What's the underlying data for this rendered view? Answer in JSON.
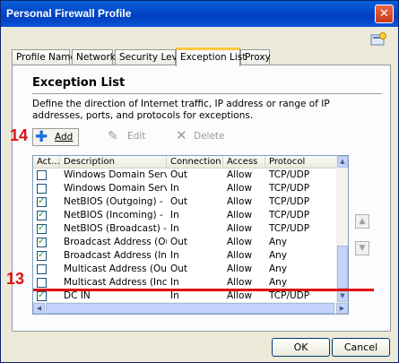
{
  "window": {
    "title": "Personal Firewall Profile",
    "close_label": "✕"
  },
  "tabs": [
    {
      "label": "Profile Name"
    },
    {
      "label": "Network"
    },
    {
      "label": "Security Level"
    },
    {
      "label": "Exception List"
    },
    {
      "label": "Proxy"
    }
  ],
  "active_tab": "Exception List",
  "section": {
    "title": "Exception List",
    "description": "Define the direction of Internet traffic, IP address or range of IP addresses, ports, and protocols for exceptions."
  },
  "toolbar": {
    "add_label": "Add",
    "edit_label": "Edit",
    "delete_label": "Delete"
  },
  "grid": {
    "columns": [
      "Act...",
      "Description",
      "Connection",
      "Access",
      "Protocol"
    ],
    "rows": [
      {
        "checked": false,
        "description": "Windows Domain Servi...",
        "connection": "Out",
        "access": "Allow",
        "protocol": "TCP/UDP"
      },
      {
        "checked": false,
        "description": "Windows Domain Servi...",
        "connection": "In",
        "access": "Allow",
        "protocol": "TCP/UDP"
      },
      {
        "checked": true,
        "description": "NetBIOS (Outgoing) - D...",
        "connection": "Out",
        "access": "Allow",
        "protocol": "TCP/UDP"
      },
      {
        "checked": true,
        "description": "NetBIOS (Incoming) - D...",
        "connection": "In",
        "access": "Allow",
        "protocol": "TCP/UDP"
      },
      {
        "checked": true,
        "description": "NetBIOS (Broadcast) - ...",
        "connection": "In",
        "access": "Allow",
        "protocol": "TCP/UDP"
      },
      {
        "checked": true,
        "description": "Broadcast Address (Ou...",
        "connection": "Out",
        "access": "Allow",
        "protocol": "Any"
      },
      {
        "checked": true,
        "description": "Broadcast Address (Inc...",
        "connection": "In",
        "access": "Allow",
        "protocol": "Any"
      },
      {
        "checked": false,
        "description": "Multicast Address (Out...",
        "connection": "Out",
        "access": "Allow",
        "protocol": "Any"
      },
      {
        "checked": false,
        "description": "Multicast Address (Inco...",
        "connection": "In",
        "access": "Allow",
        "protocol": "Any"
      },
      {
        "checked": true,
        "description": "DC IN",
        "connection": "In",
        "access": "Allow",
        "protocol": "TCP/UDP"
      }
    ]
  },
  "buttons": {
    "ok": "OK",
    "cancel": "Cancel"
  },
  "annotations": {
    "step_add": "14",
    "step_row": "13"
  },
  "colors": {
    "title_bar": "#0040c0",
    "annotation": "#e01010",
    "checkbox_check": "#21a121"
  }
}
